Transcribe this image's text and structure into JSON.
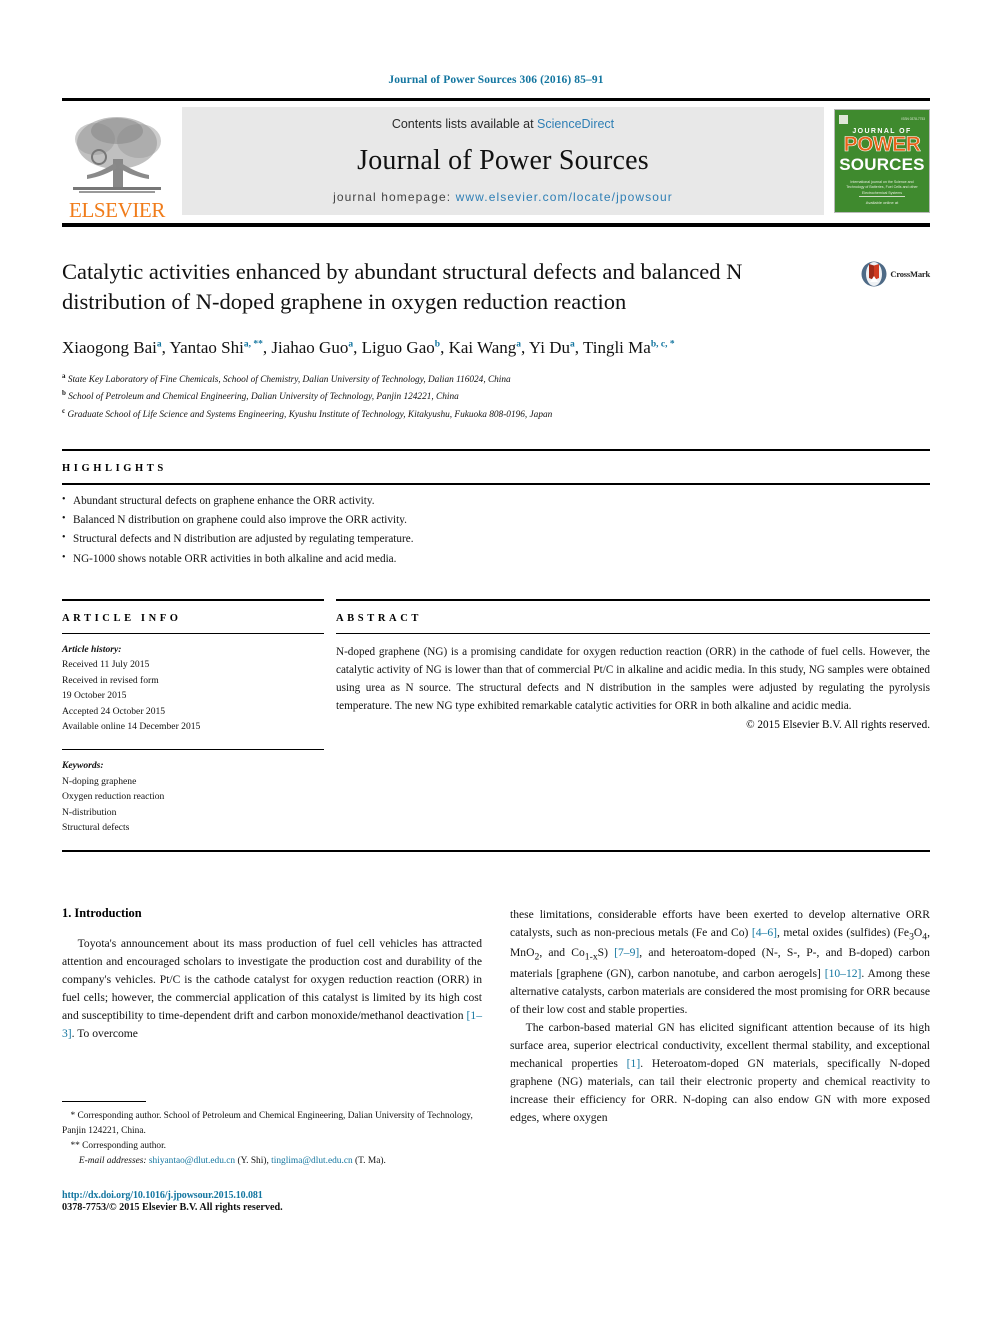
{
  "running_head": "Journal of Power Sources 306 (2016) 85–91",
  "masthead": {
    "publisher_name": "ELSEVIER",
    "contents_prefix": "Contents lists available at ",
    "contents_link": "ScienceDirect",
    "journal_title": "Journal of Power Sources",
    "homepage_prefix": "journal homepage: ",
    "homepage_url": "www.elsevier.com/locate/jpowsour",
    "cover": {
      "journal_of": "JOURNAL OF",
      "power": "POWER",
      "sources": "SOURCES",
      "blurb": "International journal on the Science and Technology of Batteries, Fuel Cells and other Electrochemical Systems",
      "footer": "Available online at"
    },
    "colors": {
      "link_blue": "#2f7fb5",
      "elsevier_orange": "#f07c1a",
      "cover_green": "#3f8a2e",
      "cover_power_orange": "#e8641a",
      "header_teal": "#1476a0"
    }
  },
  "crossmark": {
    "label": "CrossMark"
  },
  "article": {
    "title": "Catalytic activities enhanced by abundant structural defects and balanced N distribution of N-doped graphene in oxygen reduction reaction",
    "authors": [
      {
        "name": "Xiaogong Bai",
        "marks": "a",
        "sep": ", "
      },
      {
        "name": "Yantao Shi",
        "marks": "a, **",
        "sep": ", "
      },
      {
        "name": "Jiahao Guo",
        "marks": "a",
        "sep": ", "
      },
      {
        "name": "Liguo Gao",
        "marks": "b",
        "sep": ", "
      },
      {
        "name": "Kai Wang",
        "marks": "a",
        "sep": ", "
      },
      {
        "name": "Yi Du",
        "marks": "a",
        "sep": ", "
      },
      {
        "name": "Tingli Ma",
        "marks": "b, c, *",
        "sep": ""
      }
    ],
    "affiliations": [
      {
        "mark": "a",
        "text": "State Key Laboratory of Fine Chemicals, School of Chemistry, Dalian University of Technology, Dalian 116024, China"
      },
      {
        "mark": "b",
        "text": "School of Petroleum and Chemical Engineering, Dalian University of Technology, Panjin 124221, China"
      },
      {
        "mark": "c",
        "text": "Graduate School of Life Science and Systems Engineering, Kyushu Institute of Technology, Kitakyushu, Fukuoka 808-0196, Japan"
      }
    ]
  },
  "highlights": {
    "label": "HIGHLIGHTS",
    "items": [
      "Abundant structural defects on graphene enhance the ORR activity.",
      "Balanced N distribution on graphene could also improve the ORR activity.",
      "Structural defects and N distribution are adjusted by regulating temperature.",
      "NG-1000 shows notable ORR activities in both alkaline and acid media."
    ]
  },
  "article_info": {
    "label": "ARTICLE INFO",
    "history_label": "Article history:",
    "history": [
      "Received 11 July 2015",
      "Received in revised form",
      "19 October 2015",
      "Accepted 24 October 2015",
      "Available online 14 December 2015"
    ],
    "keywords_label": "Keywords:",
    "keywords": [
      "N-doping graphene",
      "Oxygen reduction reaction",
      "N-distribution",
      "Structural defects"
    ]
  },
  "abstract": {
    "label": "ABSTRACT",
    "text": "N-doped graphene (NG) is a promising candidate for oxygen reduction reaction (ORR) in the cathode of fuel cells. However, the catalytic activity of NG is lower than that of commercial Pt/C in alkaline and acidic media. In this study, NG samples were obtained using urea as N source. The structural defects and N distribution in the samples were adjusted by regulating the pyrolysis temperature. The new NG type exhibited remarkable catalytic activities for ORR in both alkaline and acidic media.",
    "copyright": "© 2015 Elsevier B.V. All rights reserved."
  },
  "body": {
    "section_number_title": "1. Introduction",
    "left_paragraph": "Toyota's announcement about its mass production of fuel cell vehicles has attracted attention and encouraged scholars to investigate the production cost and durability of the company's vehicles. Pt/C is the cathode catalyst for oxygen reduction reaction (ORR) in fuel cells; however, the commercial application of this catalyst is limited by its high cost and susceptibility to time-dependent drift and carbon monoxide/methanol deactivation ",
    "left_ref": "[1–3]",
    "left_paragraph_tail": ". To overcome",
    "right_p1_a": "these limitations, considerable efforts have been exerted to develop alternative ORR catalysts, such as non-precious metals (Fe and Co) ",
    "right_ref1": "[4–6]",
    "right_p1_b": ", metal oxides (sulfides) (Fe",
    "right_p1_c": ", MnO",
    "right_p1_d": ", and Co",
    "right_p1_e": "S) ",
    "right_ref2": "[7–9]",
    "right_p1_f": ", and heteroatom-doped (N-, S-, P-, and B-doped) carbon materials [graphene (GN), carbon nanotube, and carbon aerogels] ",
    "right_ref3": "[10–12]",
    "right_p1_g": ". Among these alternative catalysts, carbon materials are considered the most promising for ORR because of their low cost and stable properties.",
    "right_p2_a": "The carbon-based material GN has elicited significant attention because of its high surface area, superior electrical conductivity, excellent thermal stability, and exceptional mechanical properties ",
    "right_ref4": "[1]",
    "right_p2_b": ". Heteroatom-doped GN materials, specifically N-doped graphene (NG) materials, can tail their electronic property and chemical reactivity to increase their efficiency for ORR. N-doping can also endow GN with more exposed edges, where oxygen"
  },
  "footnotes": {
    "corresponding_1": "* Corresponding author. School of Petroleum and Chemical Engineering, Dalian University of Technology, Panjin 124221, China.",
    "corresponding_2": "** Corresponding author.",
    "email_label": "E-mail addresses:",
    "email_1": "shiyantao@dlut.edu.cn",
    "email_1_owner": "(Y. Shi)",
    "email_2": "tinglima@dlut.edu.cn",
    "email_2_owner": "(T. Ma).",
    "doi": "http://dx.doi.org/10.1016/j.jpowsour.2015.10.081",
    "issn": "0378-7753/© 2015 Elsevier B.V. All rights reserved."
  }
}
